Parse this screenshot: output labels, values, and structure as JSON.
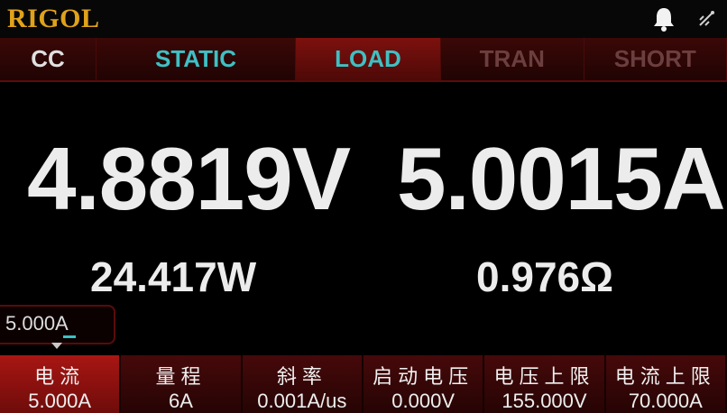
{
  "brand": "RIGOL",
  "icons": {
    "alarm": "bell-icon",
    "connection": "usb-icon"
  },
  "tabs": [
    {
      "label": "CC"
    },
    {
      "label": "STATIC"
    },
    {
      "label": "LOAD"
    },
    {
      "label": "TRAN"
    },
    {
      "label": "SHORT"
    }
  ],
  "readings": {
    "voltage": "4.8819V",
    "current": "5.0015A",
    "power": "24.417W",
    "resistance": "0.976Ω"
  },
  "setpoint": {
    "value": "5.000A"
  },
  "softkeys": [
    {
      "label": "电流",
      "value": "5.000A"
    },
    {
      "label": "量程",
      "value": "6A"
    },
    {
      "label": "斜率",
      "value": "0.001A/us"
    },
    {
      "label": "启动电压",
      "value": "0.000V"
    },
    {
      "label": "电压上限",
      "value": "155.000V"
    },
    {
      "label": "电流上限",
      "value": "70.000A"
    }
  ],
  "colors": {
    "brand": "#e0a21a",
    "accent": "#3fc0c4",
    "key_selected": "#a81613",
    "key_background": "#46090a"
  }
}
